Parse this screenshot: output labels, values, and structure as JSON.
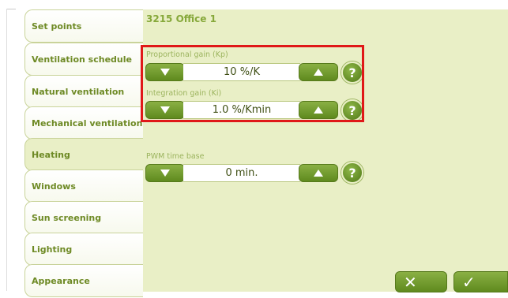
{
  "room": {
    "title": "3215 Office 1"
  },
  "tabs": [
    {
      "label": "Set points"
    },
    {
      "label": "Ventilation schedule"
    },
    {
      "label": "Natural ventilation"
    },
    {
      "label": "Mechanical ventilation"
    },
    {
      "label": "Heating"
    },
    {
      "label": "Windows"
    },
    {
      "label": "Sun screening"
    },
    {
      "label": "Lighting"
    },
    {
      "label": "Appearance"
    }
  ],
  "active_tab": "Heating",
  "fields": {
    "kp": {
      "label": "Proportional gain (Kp)",
      "value": "10 %/K"
    },
    "ki": {
      "label": "Integration gain (Ki)",
      "value": "1.0 %/Kmin"
    },
    "pwm": {
      "label": "PWM time base",
      "value": "0 min."
    }
  },
  "help_icon": {
    "glyph": "?"
  },
  "actions": {
    "cancel_glyph": "✕",
    "ok_glyph": "✓"
  },
  "colors": {
    "accent": "#6e9a2a",
    "panel": "#e9efc6",
    "tab_text": "#6e8a25",
    "highlight": "#e01818"
  }
}
